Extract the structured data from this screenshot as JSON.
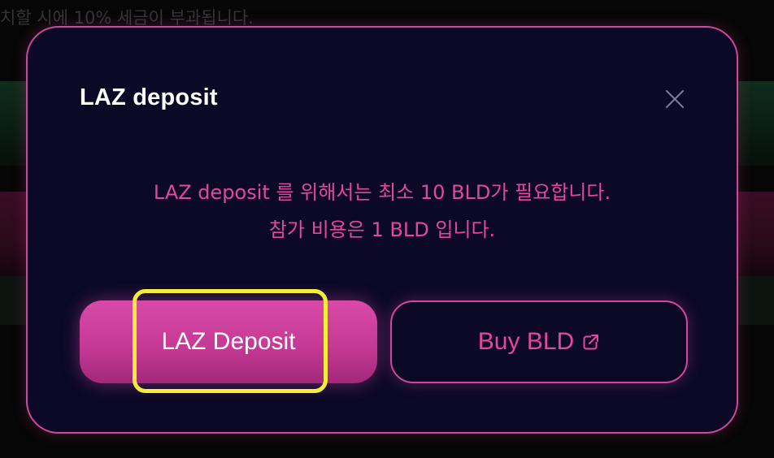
{
  "background": {
    "partial_text": "치할 시에 10% 세금이 부과됩니다."
  },
  "modal": {
    "title": "LAZ deposit",
    "message_line1": "LAZ deposit 를 위해서는 최소 10 BLD가 필요합니다.",
    "message_line2": "참가 비용은 1 BLD 입니다.",
    "primary_button_label": "LAZ Deposit",
    "secondary_button_label": "Buy BLD",
    "close_icon": "close-icon",
    "external_icon": "external-link-icon"
  },
  "colors": {
    "modal_bg": "#0b0926",
    "accent_pink": "#d2469c",
    "message_pink": "#e4479f",
    "highlight_yellow": "#f5ed3a"
  }
}
